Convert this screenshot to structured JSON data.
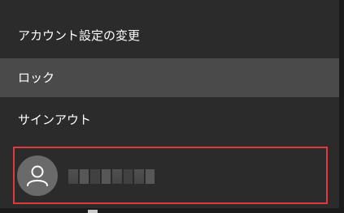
{
  "menu": {
    "items": [
      {
        "label": "アカウント設定の変更"
      },
      {
        "label": "ロック"
      },
      {
        "label": "サインアウト"
      }
    ],
    "hovered_index": 1
  },
  "user": {
    "avatar_icon": "person-icon",
    "name_obscured": true
  },
  "colors": {
    "background": "#2b2b2b",
    "hover": "#4a4a4a",
    "text": "#ffffff",
    "highlight_border": "#e0393e",
    "avatar_bg": "#6a6a6a"
  }
}
